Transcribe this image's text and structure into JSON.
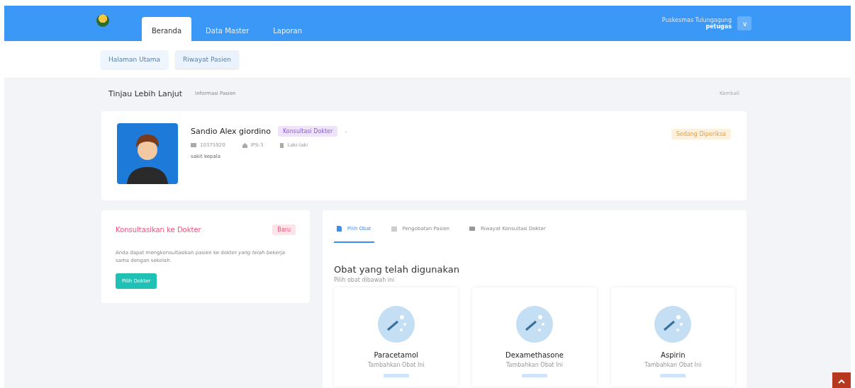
{
  "navbar": {
    "tabs": [
      {
        "label": "Beranda",
        "selected": true
      },
      {
        "label": "Data Master",
        "selected": false
      },
      {
        "label": "Laporan",
        "selected": false
      }
    ],
    "user": {
      "name": "Puskesmas Tulungagung",
      "role": "petugas",
      "menu_caret": "∨"
    }
  },
  "subnav": {
    "items": [
      {
        "label": "Halaman Utama",
        "selected": false
      },
      {
        "label": "Riwayat Pasien",
        "selected": true
      }
    ]
  },
  "breadcrumb": {
    "title": "Tinjau Lebih Lanjut",
    "subtitle": "Informasi Pasien",
    "back": "Kembali"
  },
  "patient": {
    "name": "Sandio Alex giordino",
    "badge": "Konsultasi Dokter",
    "extra": "–",
    "meta": [
      {
        "kind": "id",
        "text": "10375920"
      },
      {
        "kind": "class",
        "text": "IPS-3"
      },
      {
        "kind": "gender",
        "text": "Laki-laki"
      }
    ],
    "complaint": "sakit kepala",
    "status": "Sedang Diperiksa"
  },
  "consult": {
    "title": "Konsultasikan ke Dokter",
    "badge": "Baru",
    "text": "Anda dapat mengkonsultasikan pasien ke dokter *yang telah bekerja* sama dengan sekolah.",
    "button": "Pilih Dokter"
  },
  "medicine": {
    "tabs": [
      {
        "label": "Pilih Obat",
        "kind": "file",
        "selected": true
      },
      {
        "label": "Pengobatan Pasien",
        "kind": "list",
        "selected": false
      },
      {
        "label": "Riwayat Konsultasi Dokter",
        "kind": "table",
        "selected": false
      }
    ],
    "heading": "Obat yang telah digunakan",
    "subheading": "Pilih obat dibawah ini",
    "cards": [
      {
        "name": "Paracetamol",
        "caption": "Tambahkan Obat Ini"
      },
      {
        "name": "Dexamethasone",
        "caption": "Tambahkan Obat Ini"
      },
      {
        "name": "Aspirin",
        "caption": "Tambahkan Obat Ini"
      }
    ]
  }
}
